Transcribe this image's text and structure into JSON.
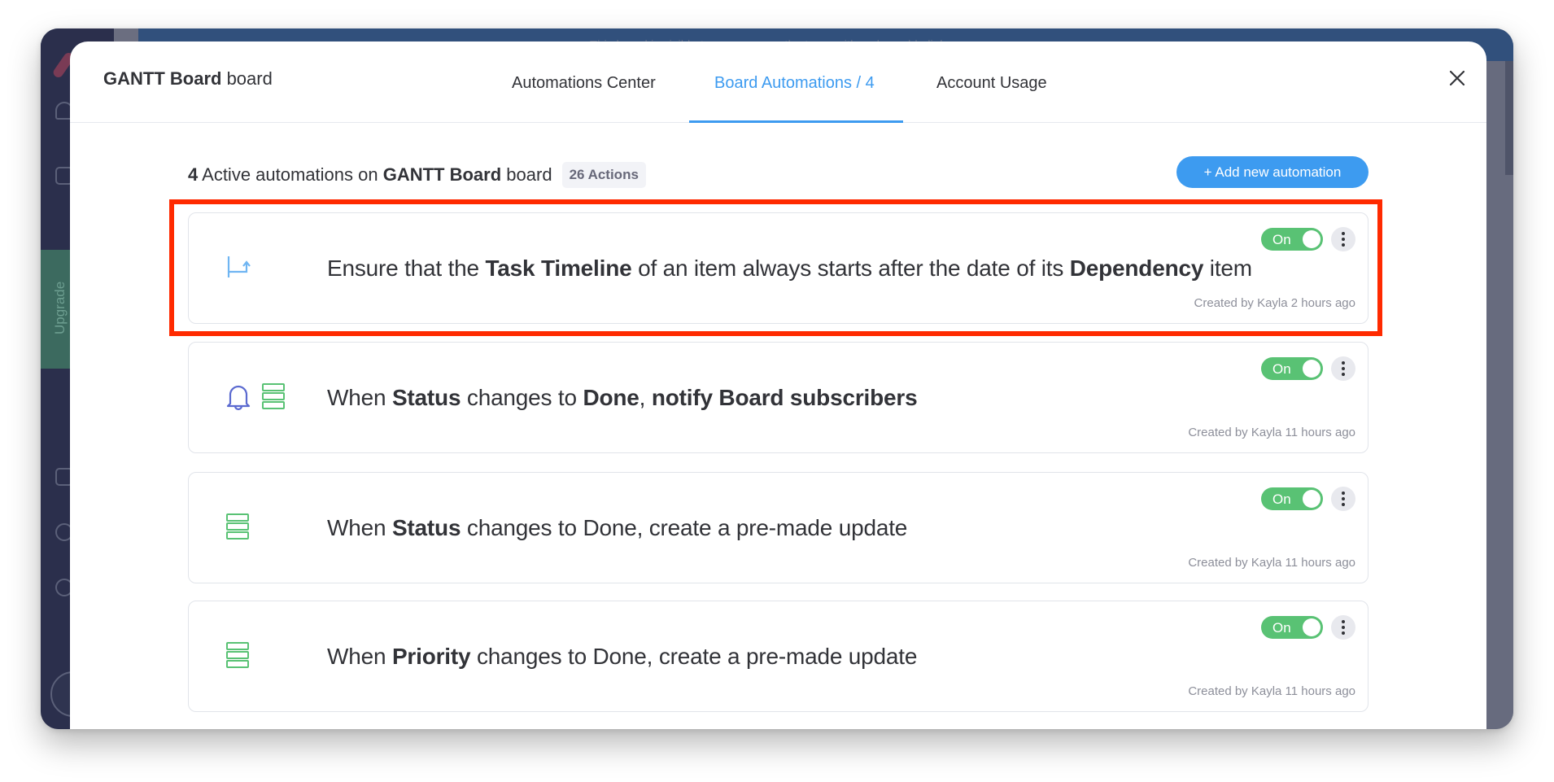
{
  "background_app": {
    "banner_text": "This board is visible to everyone on the team with a shareable link",
    "upgrade_label": "Upgrade"
  },
  "modal": {
    "title_bold": "GANTT Board",
    "title_rest": " board",
    "tabs": [
      {
        "label": "Automations Center",
        "active": false
      },
      {
        "label": "Board Automations / 4",
        "active": true
      },
      {
        "label": "Account Usage",
        "active": false
      }
    ],
    "close_icon": "close-icon"
  },
  "summary": {
    "count": "4",
    "text_before_board": " Active automations on ",
    "board_name": "GANTT Board",
    "text_after_board": " board",
    "actions_badge": "26 Actions"
  },
  "add_button_label": "+ Add new automation",
  "colors": {
    "accent_blue": "#3d9bf0",
    "toggle_green": "#59c274",
    "highlight_red": "#ff2a00",
    "bell_blue": "#5b6ad0",
    "list_green": "#59c274"
  },
  "automations": [
    {
      "icons": [
        "dependency-arrow-icon"
      ],
      "parts": [
        {
          "t": "Ensure that the ",
          "b": false
        },
        {
          "t": "Task Timeline",
          "b": true
        },
        {
          "t": " of an item always starts after the date of its ",
          "b": false
        },
        {
          "t": "Dependency",
          "b": true
        },
        {
          "t": " item",
          "b": false
        }
      ],
      "toggle_label": "On",
      "enabled": true,
      "created": "Created by Kayla 2 hours ago",
      "highlighted": true
    },
    {
      "icons": [
        "bell-icon",
        "list-icon"
      ],
      "parts": [
        {
          "t": "When ",
          "b": false
        },
        {
          "t": "Status",
          "b": true
        },
        {
          "t": " changes to ",
          "b": false
        },
        {
          "t": "Done",
          "b": true
        },
        {
          "t": ", ",
          "b": false
        },
        {
          "t": "notify Board subscribers",
          "b": true
        }
      ],
      "toggle_label": "On",
      "enabled": true,
      "created": "Created by Kayla 11 hours ago",
      "highlighted": false
    },
    {
      "icons": [
        "list-icon"
      ],
      "parts": [
        {
          "t": "When ",
          "b": false
        },
        {
          "t": "Status",
          "b": true
        },
        {
          "t": " changes to Done, create a pre-made update",
          "b": false
        }
      ],
      "toggle_label": "On",
      "enabled": true,
      "created": "Created by Kayla 11 hours ago",
      "highlighted": false
    },
    {
      "icons": [
        "list-icon"
      ],
      "parts": [
        {
          "t": "When ",
          "b": false
        },
        {
          "t": "Priority",
          "b": true
        },
        {
          "t": " changes to Done, create a pre-made update",
          "b": false
        }
      ],
      "toggle_label": "On",
      "enabled": true,
      "created": "Created by Kayla 11 hours ago",
      "highlighted": false
    }
  ]
}
